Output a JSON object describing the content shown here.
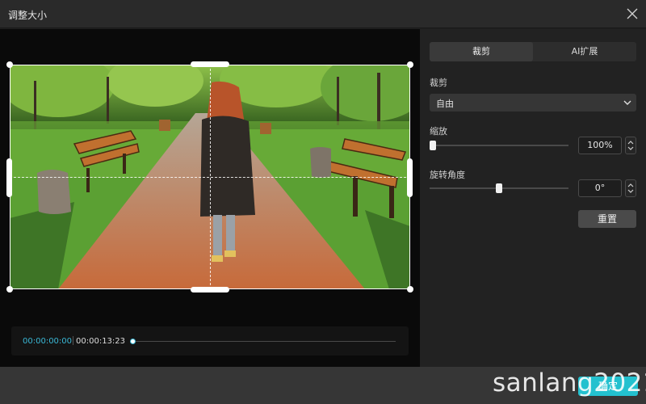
{
  "window": {
    "title": "调整大小",
    "close_icon": "close-icon"
  },
  "timeline": {
    "current_time": "00:00:00:00",
    "total_time": "00:00:13:23",
    "progress": 0
  },
  "panel": {
    "tabs": [
      {
        "label": "裁剪",
        "active": true
      },
      {
        "label": "AI扩展",
        "active": false
      }
    ],
    "crop": {
      "label": "裁剪",
      "ratio_value": "自由"
    },
    "scale": {
      "label": "缩放",
      "value": "100%",
      "slider_fraction": 0
    },
    "rotate": {
      "label": "旋转角度",
      "value": "0°",
      "slider_fraction": 0.5
    },
    "reset_label": "重置"
  },
  "footer": {
    "confirm_label": "确定"
  },
  "watermark": "sanlang2021",
  "colors": {
    "accent": "#23c1cf",
    "timecode": "#3ab8d6"
  }
}
